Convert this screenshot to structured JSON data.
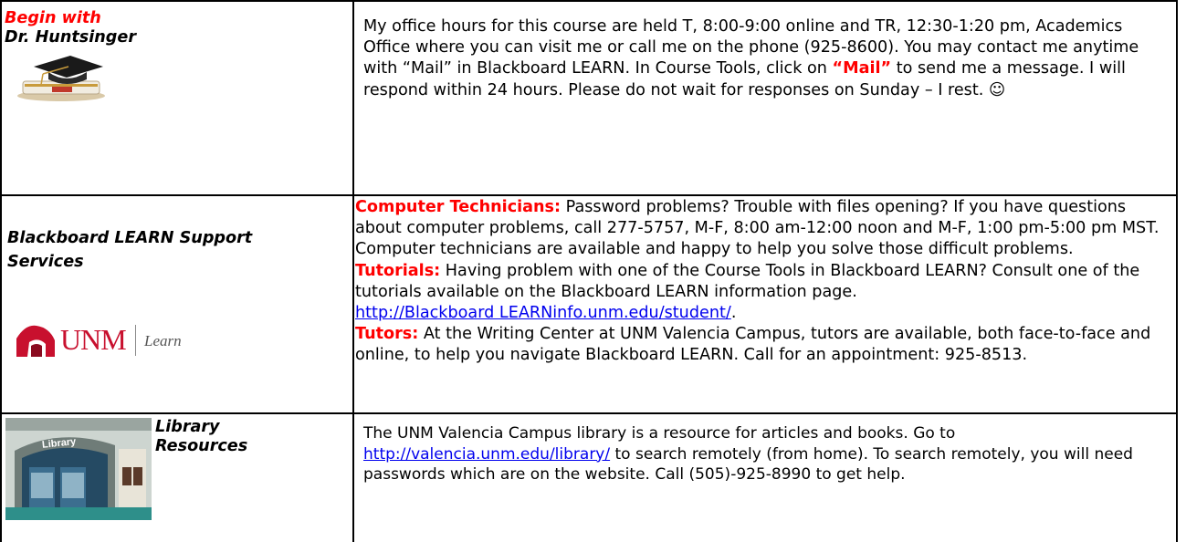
{
  "rows": [
    {
      "left": {
        "title_line1": "Begin with",
        "title_line2": "Dr. Huntsinger"
      },
      "right": {
        "text": "My office hours for this course are held T, 8:00-9:00 online and TR, 12:30-1:20 pm, Academics Office where you can visit me or call me on the phone (925-8600). You may contact me anytime with “Mail” in Blackboard LEARN.  In Course Tools, click on ",
        "mail_keyword": "“Mail”",
        "text_after": " to send me a message.  I will respond within 24 hours.  Please do not wait for responses on Sunday – I rest.  ☺"
      }
    },
    {
      "left": {
        "title": "Blackboard LEARN Support Services",
        "logo_unm": "UNM",
        "logo_learn": "Learn"
      },
      "right": {
        "tech_label": "Computer Technicians:",
        "tech_text": "  Password problems?  Trouble with files opening?  If you have questions about computer problems, call 277-5757, M-F, 8:00 am-12:00 noon and M-F, 1:00 pm-5:00 pm MST.  Computer technicians are available and happy to help you solve those difficult problems.",
        "tut_label": "Tutorials:",
        "tut_text": " Having problem with one of the Course Tools in Blackboard LEARN? Consult one of the tutorials available on the Blackboard LEARN information page.",
        "tut_link": "http://Blackboard LEARNinfo.unm.edu/student/",
        "tut_after": ".",
        "tutors_label": "Tutors:",
        "tutors_text": " At the Writing Center at UNM Valencia Campus, tutors are available, both face-to-face and online, to help you navigate Blackboard LEARN.  Call for an appointment: 925-8513."
      }
    },
    {
      "left": {
        "title_line1": "Library",
        "title_line2": "Resources",
        "photo_sign": "Library"
      },
      "right": {
        "text_before": "The UNM Valencia Campus library is a resource for articles and books.  Go to ",
        "link": "http://valencia.unm.edu/library/",
        "text_after": " to search remotely (from home).  To search remotely, you will need passwords which are on the website.  Call (505)-925-8990 to get help."
      }
    }
  ],
  "colors": {
    "red": "#ff0000",
    "link": "#0000ee",
    "unm_red": "#c8102e"
  },
  "icons": [
    "graduation-cap-icon",
    "unm-logo-icon",
    "library-photo"
  ]
}
